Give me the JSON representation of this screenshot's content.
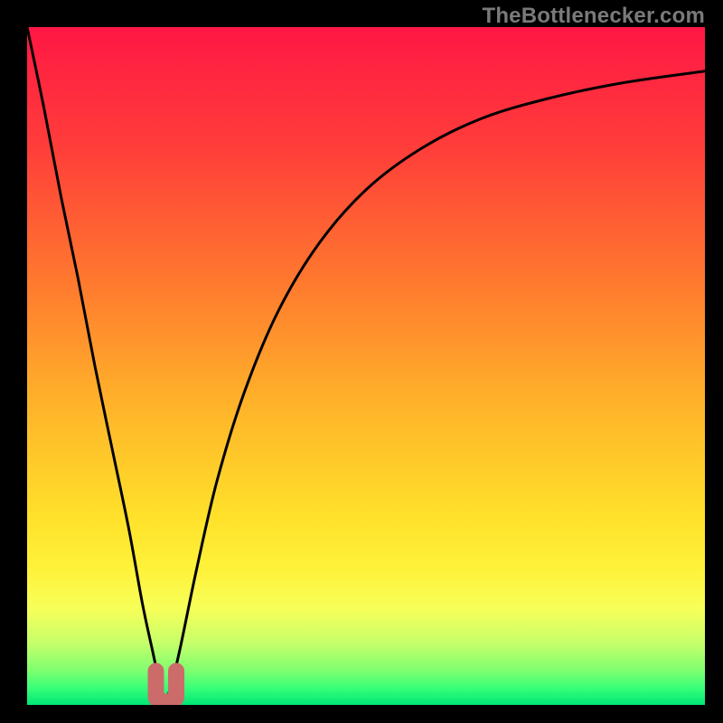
{
  "watermark": "TheBottlenecker.com",
  "colors": {
    "bg": "#000000",
    "curve": "#000000",
    "marker": "#cb6c6a",
    "gradient_stops": [
      {
        "offset": 0.0,
        "color": "#ff1744"
      },
      {
        "offset": 0.18,
        "color": "#ff3e3a"
      },
      {
        "offset": 0.38,
        "color": "#ff7a2e"
      },
      {
        "offset": 0.55,
        "color": "#ffb12a"
      },
      {
        "offset": 0.72,
        "color": "#ffe02a"
      },
      {
        "offset": 0.8,
        "color": "#fff23a"
      },
      {
        "offset": 0.86,
        "color": "#f6ff5a"
      },
      {
        "offset": 0.91,
        "color": "#c4ff6a"
      },
      {
        "offset": 0.95,
        "color": "#7dff70"
      },
      {
        "offset": 0.975,
        "color": "#38ff78"
      },
      {
        "offset": 1.0,
        "color": "#00e676"
      }
    ]
  },
  "chart_data": {
    "type": "line",
    "title": "",
    "xlabel": "",
    "ylabel": "",
    "xlim": [
      0,
      100
    ],
    "ylim": [
      0,
      100
    ],
    "grid": false,
    "legend": "none",
    "series": [
      {
        "name": "bottleneck-curve",
        "x": [
          0.0,
          2.5,
          5.0,
          7.5,
          10.0,
          12.5,
          15.0,
          17.0,
          18.5,
          19.5,
          20.3,
          21.0,
          22.5,
          25.0,
          28.0,
          32.0,
          37.0,
          43.0,
          50.0,
          58.0,
          67.0,
          77.0,
          88.0,
          100.0
        ],
        "y": [
          100.0,
          88.0,
          75.0,
          63.0,
          50.0,
          38.0,
          26.0,
          15.0,
          8.0,
          3.5,
          1.0,
          2.0,
          8.0,
          20.0,
          33.0,
          46.0,
          58.0,
          68.0,
          76.0,
          82.0,
          86.5,
          89.5,
          91.8,
          93.5
        ]
      }
    ],
    "annotations": [
      {
        "name": "min-marker",
        "shape": "u",
        "x_range": [
          19.0,
          22.0
        ],
        "y_range": [
          0.5,
          5.0
        ]
      }
    ]
  }
}
